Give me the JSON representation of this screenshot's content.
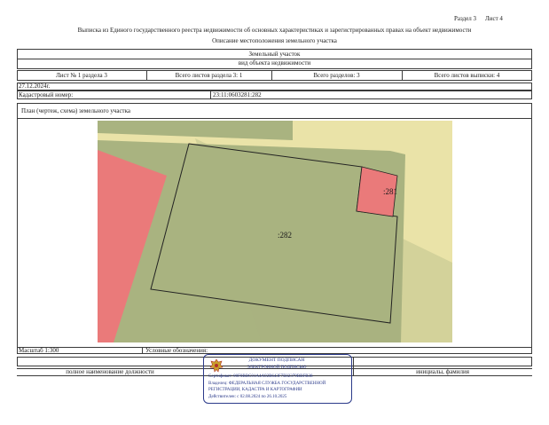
{
  "header": {
    "section_label": "Раздел 3",
    "sheet_label": "Лист 4",
    "title": "Выписка из Единого государственного реестра недвижимости об основных характеристиках и зарегистрированных правах на объект недвижимости",
    "subtitle": "Описание местоположения земельного участка"
  },
  "object": {
    "type": "Земельный участок",
    "type_caption": "вид объекта недвижимости"
  },
  "sheets_row": {
    "sheet_no": "Лист № 1 раздела 3",
    "sheets_in_section": "Всего листов раздела 3: 1",
    "sections_total": "Всего разделов: 3",
    "sheets_total": "Всего листов выписки: 4"
  },
  "date": "27.12.2024г.",
  "cadastral": {
    "label": "Кадастровый номер:",
    "value": "23:11:0603281:282"
  },
  "plan": {
    "title": "План (чертеж, схема) земельного участка",
    "label_main": ":282",
    "label_neighbor": ":281"
  },
  "footer": {
    "scale_label": "Масштаб 1:300",
    "legend_label": "Условные обозначения:",
    "position_caption": "полное наименование должности",
    "name_caption": "инициалы, фамилия"
  },
  "stamp": {
    "title": "ДОКУМЕНТ ПОДПИСАН",
    "subtitle": "ЭЛЕКТРОННОЙ ПОДПИСЬЮ",
    "certificate": "Сертификат: 00F0BBC01A4A92B643F7E82379BBFB38",
    "owner_line1": "Владелец: ФЕДЕРАЛЬНАЯ СЛУЖБА ГОСУДАРСТВЕННОЙ",
    "owner_line2": "РЕГИСТРАЦИИ, КАДАСТРА И КАРТОГРАФИИ",
    "validity": "Действителен: с 02.08.2024 по 26.10.2025"
  },
  "colors": {
    "parcel_fill": "#a9b380",
    "neighbor_fill": "#ea7a7a",
    "background_fill": "#eae3a8",
    "stamp_color": "#2b3a8a"
  }
}
